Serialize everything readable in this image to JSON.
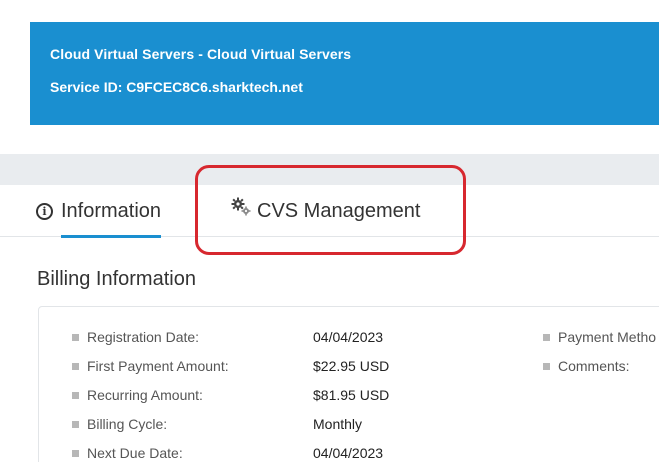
{
  "service": {
    "title": "Cloud Virtual Servers - Cloud Virtual Servers",
    "service_id": "Service ID: C9FCEC8C6.sharktech.net"
  },
  "tabs": [
    {
      "label": "Information",
      "icon": "info-circle-icon",
      "active": true
    },
    {
      "label": "CVS Management",
      "icon": "gears-icon",
      "active": false
    }
  ],
  "billing": {
    "title": "Billing Information",
    "rows": [
      {
        "label": "Registration Date:",
        "value": "04/04/2023"
      },
      {
        "label": "First Payment Amount:",
        "value": "$22.95 USD"
      },
      {
        "label": "Recurring Amount:",
        "value": "$81.95 USD"
      },
      {
        "label": "Billing Cycle:",
        "value": "Monthly"
      },
      {
        "label": "Next Due Date:",
        "value": "04/04/2023"
      }
    ],
    "right_rows": [
      {
        "label": "Payment Metho"
      },
      {
        "label": "Comments:"
      }
    ]
  },
  "colors": {
    "brand": "#1a8fd0",
    "highlight": "#d7282f"
  }
}
